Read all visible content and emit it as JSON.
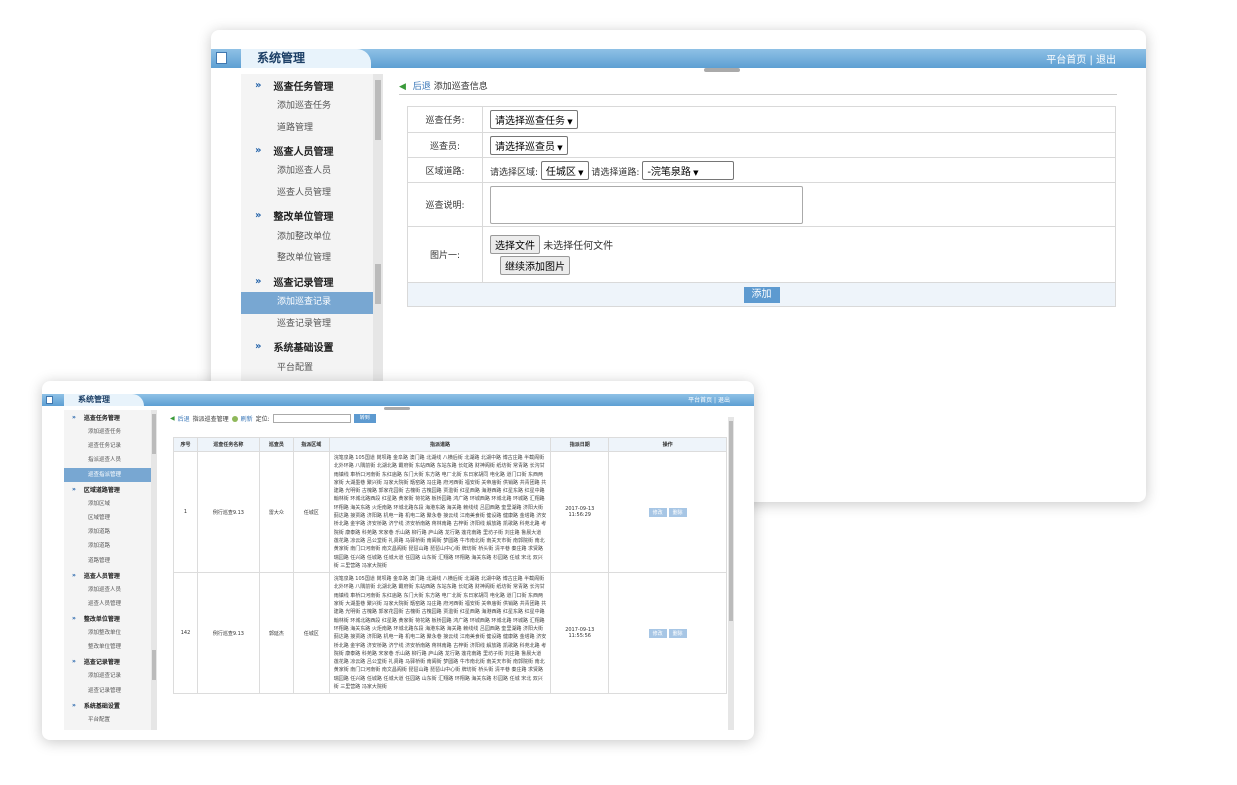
{
  "top_window": {
    "title": "系统管理",
    "header_links": {
      "home": "平台首页",
      "sep": "|",
      "logout": "退出"
    },
    "sidebar": [
      {
        "type": "section",
        "label": "巡查任务管理"
      },
      {
        "type": "item",
        "label": "添加巡查任务"
      },
      {
        "type": "item",
        "label": "道路管理"
      },
      {
        "type": "section",
        "label": "巡查人员管理"
      },
      {
        "type": "item",
        "label": "添加巡查人员"
      },
      {
        "type": "item",
        "label": "巡查人员管理"
      },
      {
        "type": "section",
        "label": "整改单位管理"
      },
      {
        "type": "item",
        "label": "添加整改单位"
      },
      {
        "type": "item",
        "label": "整改单位管理"
      },
      {
        "type": "section",
        "label": "巡查记录管理"
      },
      {
        "type": "item",
        "label": "添加巡查记录",
        "active": true
      },
      {
        "type": "item",
        "label": "巡查记录管理"
      },
      {
        "type": "section",
        "label": "系统基础设置"
      },
      {
        "type": "item",
        "label": "平台配置"
      }
    ],
    "breadcrumb": {
      "back": "后退",
      "page": "添加巡查信息"
    },
    "form": {
      "task_label": "巡查任务:",
      "task_value": "请选择巡查任务",
      "inspector_label": "巡查员:",
      "inspector_value": "请选择巡查员",
      "area_road_label": "区域道路:",
      "area_prompt": "请选择区域:",
      "area_value": "任城区",
      "road_prompt": "请选择道路:",
      "road_value": "-浣笔泉路",
      "desc_label": "巡查说明:",
      "desc_value": "",
      "image_label": "图片一:",
      "choose_file": "选择文件",
      "no_file": "未选择任何文件",
      "add_more": "继续添加图片",
      "submit": "添加"
    }
  },
  "bottom_window": {
    "title": "系统管理",
    "header_links": {
      "home": "平台首页",
      "sep": "|",
      "logout": "退出"
    },
    "sidebar": [
      {
        "type": "section",
        "label": "巡查任务管理"
      },
      {
        "type": "item",
        "label": "添加巡查任务"
      },
      {
        "type": "item",
        "label": "巡查任务记录"
      },
      {
        "type": "item",
        "label": "指派巡查人员"
      },
      {
        "type": "item",
        "label": "巡查指派管理",
        "active": true
      },
      {
        "type": "section",
        "label": "区域道路管理"
      },
      {
        "type": "item",
        "label": "添加区域"
      },
      {
        "type": "item",
        "label": "区域管理"
      },
      {
        "type": "item",
        "label": "添加道路"
      },
      {
        "type": "item",
        "label": "添加道路"
      },
      {
        "type": "item",
        "label": "道路管理"
      },
      {
        "type": "section",
        "label": "巡查人员管理"
      },
      {
        "type": "item",
        "label": "添加巡查人员"
      },
      {
        "type": "item",
        "label": "巡查人员管理"
      },
      {
        "type": "section",
        "label": "整改单位管理"
      },
      {
        "type": "item",
        "label": "添加整改单位"
      },
      {
        "type": "item",
        "label": "整改单位管理"
      },
      {
        "type": "section",
        "label": "巡查记录管理"
      },
      {
        "type": "item",
        "label": "添加巡查记录"
      },
      {
        "type": "item",
        "label": "巡查记录管理"
      },
      {
        "type": "section",
        "label": "系统基础设置"
      },
      {
        "type": "item",
        "label": "平台配置"
      }
    ],
    "toolbar": {
      "back": "后退",
      "page": "指派巡查管理",
      "refresh": "刷新",
      "locate": "定位:",
      "go": "转到"
    },
    "columns": [
      "序号",
      "巡查任务名称",
      "巡查员",
      "指派区域",
      "指派道路",
      "指派日期",
      "操作"
    ],
    "rows": [
      {
        "no": "1",
        "task": "例行巡查9.13",
        "inspector": "雷大众",
        "area": "任城区",
        "date": "2017-09-13",
        "time": "11:56:29",
        "edit": "修改",
        "delete": "删除"
      },
      {
        "no": "142",
        "task": "例行巡查9.13",
        "inspector": "郭延杰",
        "area": "任城区",
        "date": "2017-09-13",
        "time": "11:55:56",
        "edit": "修改",
        "delete": "删除"
      }
    ],
    "roads_text": "浣笔泉路 105国道 岗坝路 金阜路 澳门路 北湖线 八横后街 北湖路 北湖中路 博古庄路 半截阁街 北外环路 八隅前街 北湖北路 霸府街 东站西路 东站东路 长虹路 财神阁街 纸坊街 常青路 长沟甘雨镇线 車桥口河南街 东红庙路 东门大街 东方路 电厂北街 东日家胡同 电化路 道门口街 东西两家街 大湖墨巷 聚兴街 冯家大院街 甑窑路 冯庄路 府河西街 福安街 关帝庙街 供销路 共青团路 共建路 光明街 古槐路 郭家花园街 古槐街 古槐园路 贾滥街 红星西路 海港西路 红星东路 红星中路 翰林街 环城北路西段 红星路 黄家街 荷花路 板桥园路 鸿广路 环城西路 环城北路 环城路 汇翔路 环翔路 海关东路 火炬南路 环城北路东段 海港东路 海关路 赖线线 吕园西路 奎里湖路 济阳大街 蓟达路 接贾路 济阳路 机电一路 机电二路 聚永巷 接云线 江南美食街 健设路 健康路 金塔路 济安桥北路 金宇路 济安桥路 济宁线 济安桥南路 蒋林南路 古梓街 济阳线 解放路 凯歌路 科苑北路 考院街 康泰路 科苑路 宋家巷 乐山路 柳行路 庐山路 龙行路 莲花南路 里坊子街 刘庄路 鲁晨大道 莲花路 凉云路 吕公堂街 礼贤路 马驿桥街 南阖街 梦圆路 牛市南北街 南关天市街 南郭院街 南北黄家街 南门口河南街 南文昌阁街 琵琶山路 琵琶山中心街 牌坊街 桥头街 清平巷 秦庄路 求贤路 瑞园路 任兴路 任城路 任城大道 任园路 山东街 汇翔路 环翔路 海关东路 杉园路 任城 宋北 双兴街 三里营路 冯家大院街"
  }
}
